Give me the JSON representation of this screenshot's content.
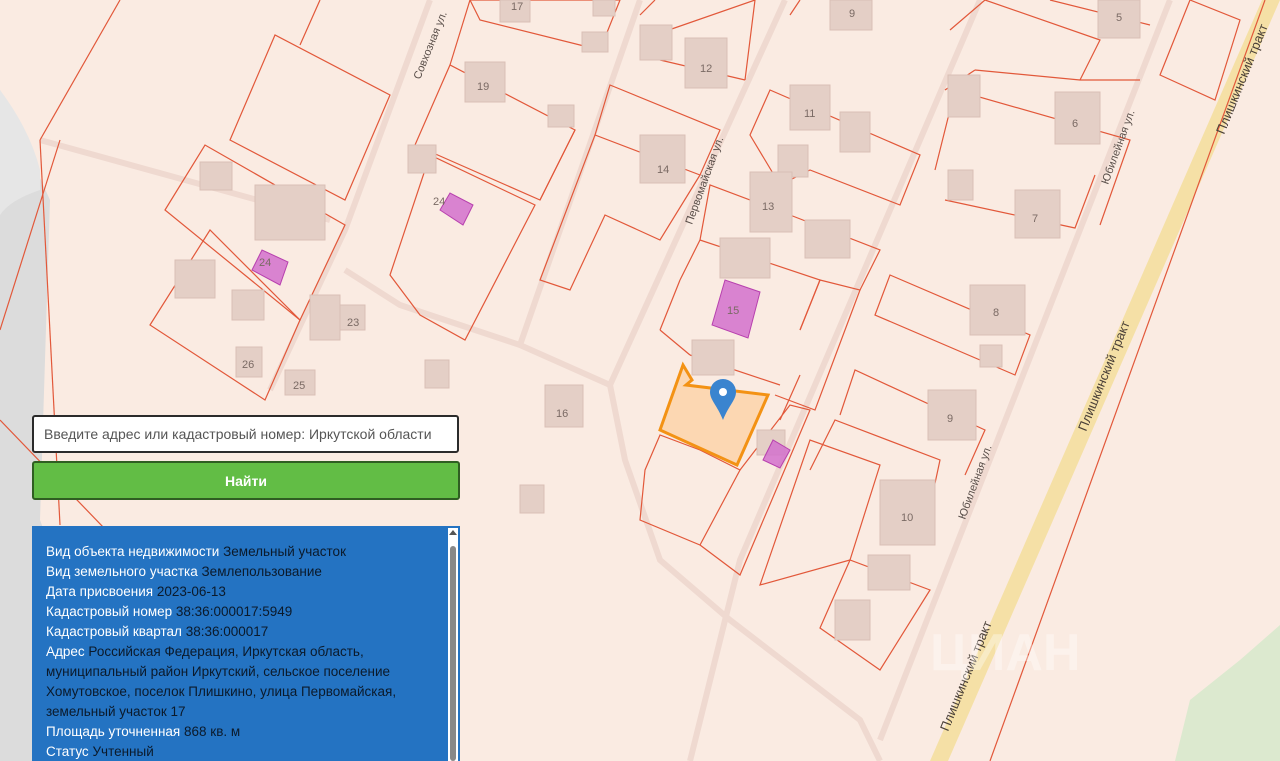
{
  "map": {
    "streets": {
      "sovkhoznaya": "Совхозная ул.",
      "pervomayskaya": "Первомайская ул.",
      "yubileynaya": "Юбилейная ул.",
      "plishkinsky": "Плишкинский тракт"
    },
    "house_numbers": [
      "17",
      "9",
      "5",
      "12",
      "19",
      "11",
      "6",
      "14",
      "13",
      "7",
      "24",
      "24",
      "15",
      "8",
      "23",
      "26",
      "25",
      "16",
      "9",
      "10"
    ],
    "watermark": "ЦИАН",
    "colors": {
      "background": "#faebe2",
      "parcel_border": "#e2583a",
      "building": "#e4cfc6",
      "registered_building": "#d067c8",
      "selected_parcel_fill": "#fbd3a9",
      "selected_parcel_border": "#f39214",
      "marker": "#3a84cf",
      "highway": "#f5e0a6",
      "water": "#d9d9d9",
      "forest": "#d9e9cf"
    }
  },
  "search": {
    "placeholder": "Введите адрес или кадастровый номер: Иркутской области",
    "button_label": "Найти"
  },
  "info": {
    "rows": [
      {
        "label": "Вид объекта недвижимости",
        "value": "Земельный участок"
      },
      {
        "label": "Вид земельного участка",
        "value": "Землепользование"
      },
      {
        "label": "Дата присвоения",
        "value": "2023-06-13"
      },
      {
        "label": "Кадастровый номер",
        "value": "38:36:000017:5949"
      },
      {
        "label": "Кадастровый квартал",
        "value": "38:36:000017"
      },
      {
        "label": "Адрес",
        "value": "Российская Федерация, Иркутская область, муниципальный район Иркутский, сельское поселение Хомутовское, поселок Плишкино, улица Первомайская, земельный участок 17"
      },
      {
        "label": "Площадь уточненная",
        "value": "868 кв. м"
      },
      {
        "label": "Статус",
        "value": "Учтенный"
      }
    ]
  }
}
